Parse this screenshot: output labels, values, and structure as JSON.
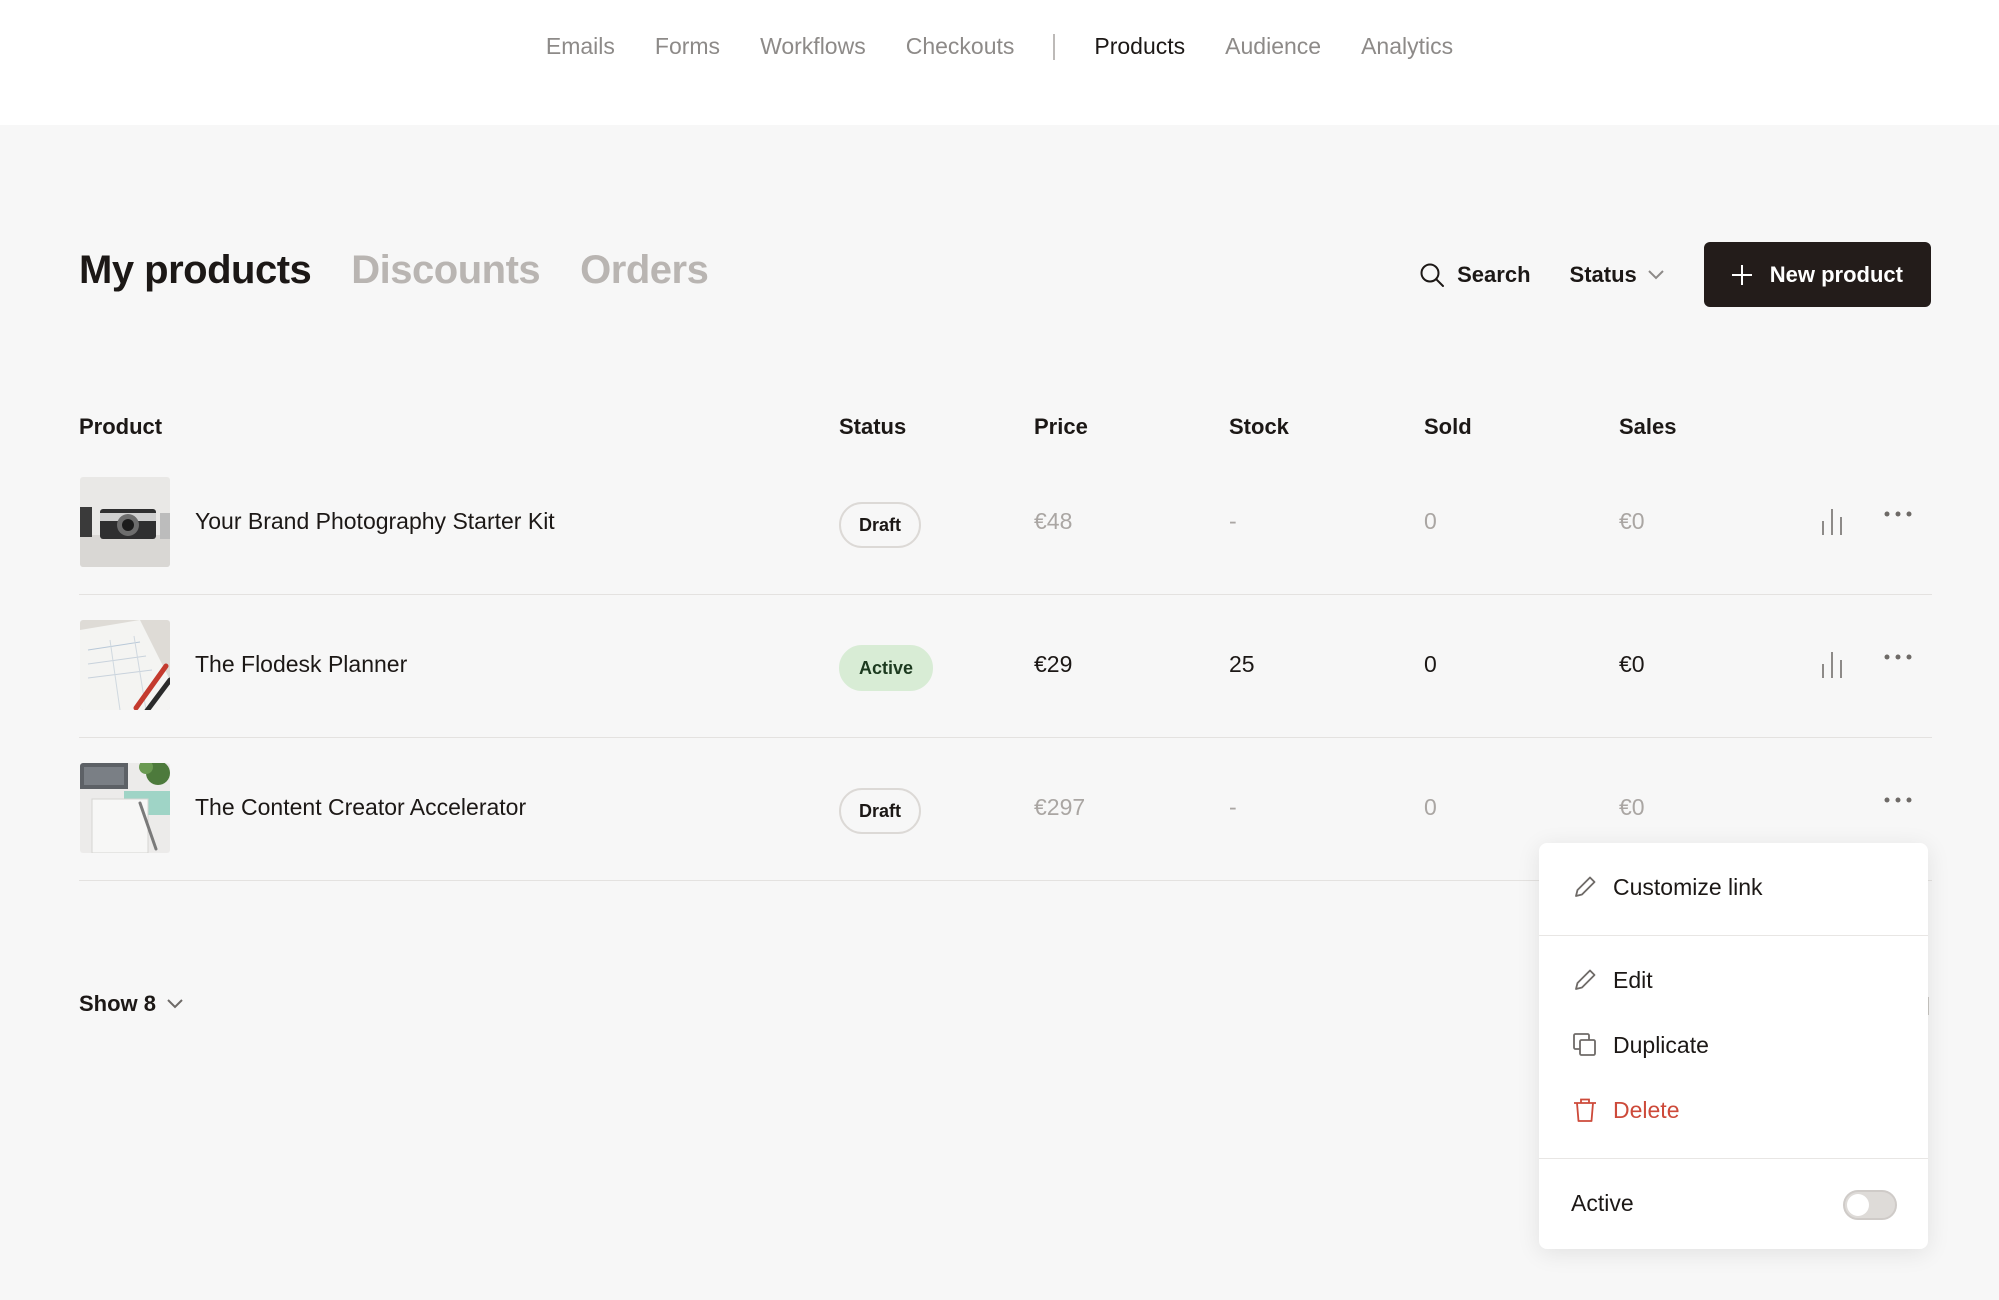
{
  "top_nav": {
    "items_left": [
      "Emails",
      "Forms",
      "Workflows",
      "Checkouts"
    ],
    "items_right": [
      "Products",
      "Audience",
      "Analytics"
    ],
    "active": "Products"
  },
  "page_tabs": [
    "My products",
    "Discounts",
    "Orders"
  ],
  "toolbar": {
    "search_label": "Search",
    "status_label": "Status",
    "new_product_label": "New product"
  },
  "table": {
    "headers": {
      "product": "Product",
      "status": "Status",
      "price": "Price",
      "stock": "Stock",
      "sold": "Sold",
      "sales": "Sales"
    },
    "rows": [
      {
        "name": "Your Brand Photography Starter Kit",
        "status": "Draft",
        "price": "€48",
        "stock": "-",
        "sold": "0",
        "sales": "€0"
      },
      {
        "name": "The Flodesk Planner",
        "status": "Active",
        "price": "€29",
        "stock": "25",
        "sold": "0",
        "sales": "€0"
      },
      {
        "name": "The Content Creator Accelerator",
        "status": "Draft",
        "price": "€297",
        "stock": "-",
        "sold": "0",
        "sales": "€0"
      }
    ]
  },
  "show_label": "Show 8",
  "context_menu": {
    "customize_link": "Customize link",
    "edit": "Edit",
    "duplicate": "Duplicate",
    "delete": "Delete",
    "active_label": "Active",
    "active_toggle_on": false
  },
  "colors": {
    "accent_dark": "#231c1a",
    "active_badge_bg": "#d8ecd5",
    "delete_red": "#cd4a3a"
  }
}
